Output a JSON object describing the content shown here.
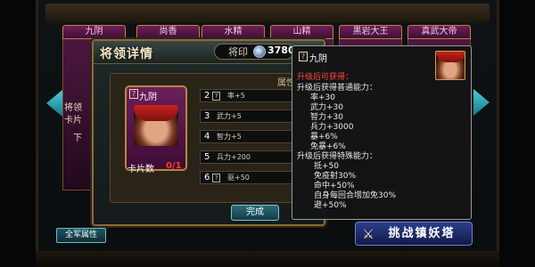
{
  "top_tabs": [
    "九阴",
    "尚香",
    "水精",
    "山精",
    "黑岩大王",
    "真武大帝"
  ],
  "left_card": {
    "line1": "将领",
    "line2": "卡片",
    "line3": "下"
  },
  "window": {
    "title": "将领详情",
    "seal_label": "将印",
    "seal_count": "3780",
    "attr_header": "属性"
  },
  "hero_card": {
    "name": "九阴",
    "card_count_label": "卡片数",
    "card_count_value": "0/1"
  },
  "level_rows": [
    {
      "level": "2",
      "text": "率+5"
    },
    {
      "level": "3",
      "text": "武力+5"
    },
    {
      "level": "4",
      "text": "智力+5"
    },
    {
      "level": "5",
      "text": "兵力+200"
    },
    {
      "level": "6",
      "text": "驱+50"
    }
  ],
  "complete_button": "完成",
  "tooltip": {
    "name": "九阴",
    "lines": [
      {
        "style": "red",
        "text": "升级后可获得："
      },
      {
        "style": "plain",
        "text": "升级后获得普通能力："
      },
      {
        "style": "ind",
        "text": "率+30"
      },
      {
        "style": "ind",
        "text": "武力+30"
      },
      {
        "style": "ind",
        "text": "智力+30"
      },
      {
        "style": "ind",
        "text": "兵力+3000"
      },
      {
        "style": "ind",
        "text": "暴+6%"
      },
      {
        "style": "ind",
        "text": "免暴+6%"
      },
      {
        "style": "plain",
        "text": "升级后获得特殊能力："
      },
      {
        "style": "ind2",
        "text": "抵+50"
      },
      {
        "style": "ind2",
        "text": "免疫射30%"
      },
      {
        "style": "ind2",
        "text": "命中+50%"
      },
      {
        "style": "ind2",
        "text": "自身每回合增加免30%"
      },
      {
        "style": "ind2",
        "text": "避+50%"
      }
    ]
  },
  "bottom": {
    "army_button": "全军属性",
    "challenge_button": "挑战镇妖塔"
  },
  "colors": {
    "accent_gold": "#b7863f",
    "card_purple": "#6b1f5c",
    "red_text": "#ff4c3a",
    "teal_button": "#2c6c78"
  },
  "icons": [
    "seal-gem-icon",
    "left-arrow-icon",
    "right-arrow-icon",
    "crossed-swords-icon"
  ]
}
